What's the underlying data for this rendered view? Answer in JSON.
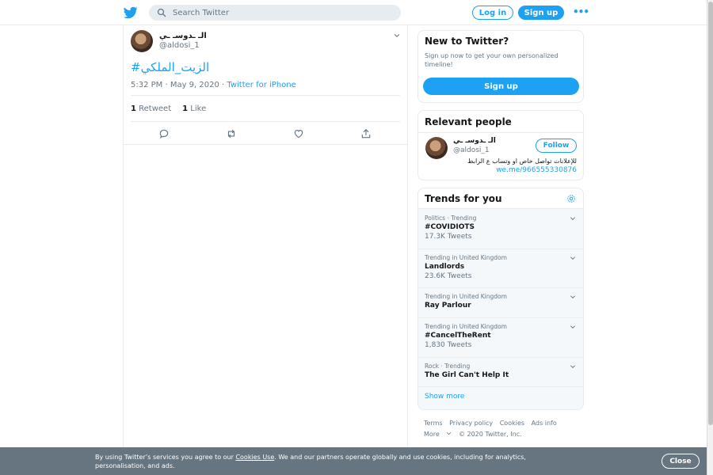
{
  "header": {
    "search_placeholder": "Search Twitter",
    "login_label": "Log in",
    "signup_label": "Sign up",
    "more_label": "•••"
  },
  "tweet": {
    "author_name": "الـ ـدوسـ ـي",
    "author_handle": "@aldosi_1",
    "text": "#الزيت_الملكي",
    "time": "5:32 PM · May 9, 2020 · ",
    "source": "Twitter for iPhone",
    "retweet_count": "1",
    "retweet_label": "Retweet",
    "like_count": "1",
    "like_label": "Like"
  },
  "new_to_twitter": {
    "title": "New to Twitter?",
    "description": "Sign up now to get your own personalized timeline!",
    "signup_label": "Sign up"
  },
  "relevant_people": {
    "title": "Relevant people",
    "name": "الـ ـدوسـ ـي",
    "handle": "@aldosi_1",
    "follow_label": "Follow",
    "bio": "للإعلانات تواصل خاص او وتساب ع الرابط",
    "link": "we.me/966555330876"
  },
  "trends": {
    "title": "Trends for you",
    "items": [
      {
        "context": "Politics · Trending",
        "name": "#COVIDIOTS",
        "count": "17.3K Tweets"
      },
      {
        "context": "Trending in United Kingdom",
        "name": "Landlords",
        "count": "23.6K Tweets"
      },
      {
        "context": "Trending in United Kingdom",
        "name": "Ray Parlour",
        "count": ""
      },
      {
        "context": "Trending in United Kingdom",
        "name": "#CancelTheRent",
        "count": "1,830 Tweets"
      },
      {
        "context": "Rock · Trending",
        "name": "The Girl Can't Help It",
        "count": ""
      }
    ],
    "show_more": "Show more"
  },
  "footer": {
    "terms": "Terms",
    "privacy": "Privacy policy",
    "cookies": "Cookies",
    "ads": "Ads info",
    "more": "More",
    "copyright": "© 2020 Twitter, Inc."
  },
  "cookie_bar": {
    "text_before": "By using Twitter’s services you agree to our ",
    "link": "Cookies Use",
    "text_after": ". We and our partners operate globally and use cookies, including for analytics, personalisation, and ads.",
    "close_label": "Close"
  },
  "colors": {
    "accent": "#1da1f2",
    "text": "#14171a",
    "muted": "#657786",
    "cookie_bg": "#66757f"
  }
}
